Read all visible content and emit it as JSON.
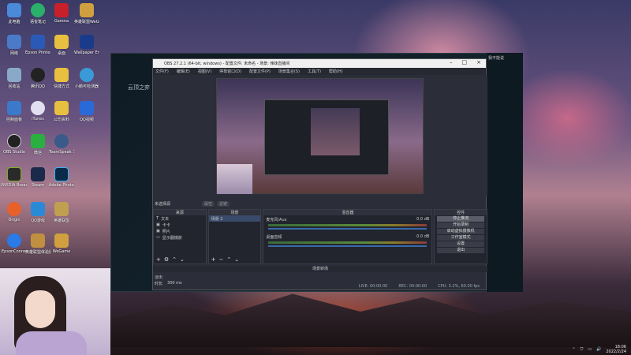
{
  "desktop": {
    "icons": [
      {
        "label": "此电脑"
      },
      {
        "label": "语雀笔记"
      },
      {
        "label": "Garena"
      },
      {
        "label": "英雄联盟WeGame"
      },
      {
        "label": "网络"
      },
      {
        "label": "Epson Printer C..."
      },
      {
        "label": "桌面"
      },
      {
        "label": "Wallpaper Engine"
      },
      {
        "label": "回收站"
      },
      {
        "label": "腾讯QQ"
      },
      {
        "label": "快捷方式"
      },
      {
        "label": "小鹅可检测器"
      },
      {
        "label": "控制面板"
      },
      {
        "label": "iTunes"
      },
      {
        "label": "公司资料"
      },
      {
        "label": "QQ视频"
      },
      {
        "label": "OBS Studio"
      },
      {
        "label": "微信"
      },
      {
        "label": "TeamSpeak 3"
      },
      {
        "label": "NVIDIA Broadcast"
      },
      {
        "label": "Steam"
      },
      {
        "label": "Adobe Photosh..."
      },
      {
        "label": "Origin"
      },
      {
        "label": "QQ游戏"
      },
      {
        "label": "英雄联盟"
      },
      {
        "label": "EpsonConnect Site"
      },
      {
        "label": "英雄联盟体验服"
      },
      {
        "label": "WeGame"
      }
    ]
  },
  "lol": {
    "title": "云顶之弈",
    "right_label": "我不能说"
  },
  "obs": {
    "title": "OBS 27.2.1 (64-bit, windows) - 配置文件: 未命名 - 场景: 辣妹直播间",
    "menu": [
      "文件(F)",
      "编辑(E)",
      "视图(V)",
      "停靠窗口(D)",
      "配置文件(P)",
      "场景集合(S)",
      "工具(T)",
      "帮助(H)"
    ],
    "no_source": "未选择源",
    "props_button": "属性",
    "filters_button": "滤镜",
    "docks": {
      "sources_header": "来源",
      "scenes_header": "场景",
      "mixer_header": "混音器",
      "controls_header": "控件",
      "sources": [
        "文本",
        "卡卡",
        "照片",
        "显示器捕获"
      ],
      "scenes": [
        "场景 2"
      ],
      "mixer": [
        {
          "name": "麦克风/Aux",
          "db": "0.0 dB"
        },
        {
          "name": "桌面音频",
          "db": "0.0 dB"
        }
      ],
      "controls": [
        "停止推流",
        "开始录制",
        "启动虚拟摄像机",
        "工作室模式",
        "设置",
        "退出"
      ]
    },
    "transition_header": "场景转场",
    "transition": "淡出",
    "duration_label": "时长",
    "duration_value": "300 ms",
    "status": {
      "live": "LIVE: 00:00:00",
      "rec": "REC: 00:00:00",
      "cpu": "CPU: 3.2%, 60.00 fps"
    }
  },
  "taskbar": {
    "time": "18:06",
    "date": "2022/2/24"
  }
}
